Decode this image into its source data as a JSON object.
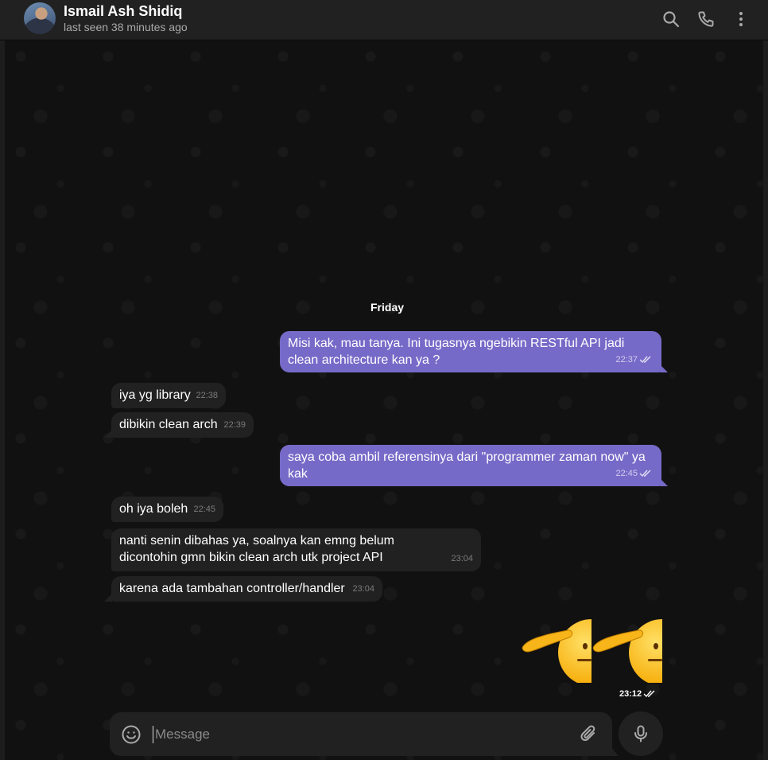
{
  "header": {
    "name": "Ismail Ash Shidiq",
    "status": "last seen 38 minutes ago",
    "icons": [
      "search-icon",
      "phone-icon",
      "more-vertical-icon"
    ]
  },
  "chat": {
    "date_label": "Friday",
    "messages": [
      {
        "direction": "out",
        "text": "Misi kak, mau tanya. Ini tugasnya ngebikin RESTful API jadi clean architecture kan ya ?",
        "time": "22:37",
        "read": true
      },
      {
        "direction": "in",
        "text": "iya yg library",
        "time": "22:38"
      },
      {
        "direction": "in",
        "text": "dibikin clean arch",
        "time": "22:39"
      },
      {
        "direction": "out",
        "text": "saya coba ambil referensinya dari \"programmer zaman now\" ya kak",
        "time": "22:45",
        "read": true
      },
      {
        "direction": "in",
        "text": "oh iya boleh",
        "time": "22:45"
      },
      {
        "direction": "in",
        "text": "nanti senin dibahas ya, soalnya kan emng belum dicontohin gmn bikin clean arch utk project API",
        "time": "23:04"
      },
      {
        "direction": "in",
        "text": "karena ada tambahan controller/handler",
        "time": "23:04"
      },
      {
        "direction": "out",
        "type": "sticker",
        "content": "saluting-face-emoji x2",
        "time": "23:12",
        "read": true
      }
    ]
  },
  "composer": {
    "placeholder": "Message",
    "icons": [
      "emoji-icon",
      "attach-icon",
      "mic-icon"
    ]
  },
  "colors": {
    "outgoing_bubble": "#766ac8",
    "incoming_bubble": "#212121",
    "header_bg": "#212121",
    "chat_bg": "#111111"
  }
}
